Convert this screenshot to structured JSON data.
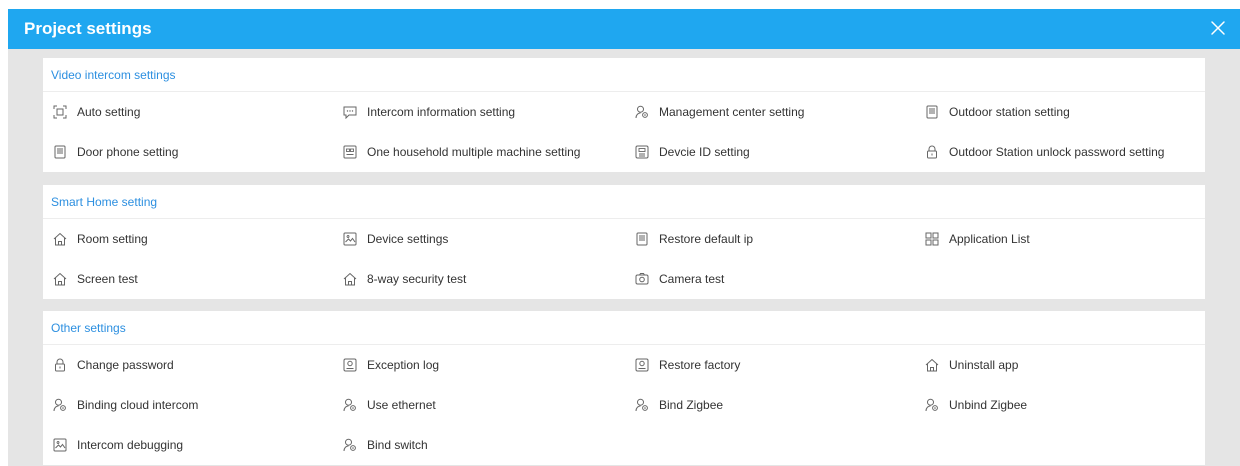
{
  "header": {
    "title": "Project settings",
    "background": "#1fa7f0"
  },
  "sections": [
    {
      "title": "Video intercom settings",
      "items": [
        {
          "label": "Auto setting",
          "icon": "scan-icon"
        },
        {
          "label": "Intercom information setting",
          "icon": "message-icon"
        },
        {
          "label": "Management center setting",
          "icon": "user-settings-icon"
        },
        {
          "label": "Outdoor station setting",
          "icon": "device-panel-icon"
        },
        {
          "label": "Door phone setting",
          "icon": "device-panel-icon"
        },
        {
          "label": "One household multiple machine setting",
          "icon": "multi-device-icon"
        },
        {
          "label": "Devcie ID setting",
          "icon": "id-device-icon"
        },
        {
          "label": "Outdoor Station unlock password setting",
          "icon": "lock-icon"
        }
      ]
    },
    {
      "title": "Smart Home setting",
      "items": [
        {
          "label": "Room setting",
          "icon": "home-icon"
        },
        {
          "label": "Device settings",
          "icon": "image-monitor-icon"
        },
        {
          "label": "Restore default ip",
          "icon": "device-panel-icon"
        },
        {
          "label": "Application List",
          "icon": "grid-icon"
        },
        {
          "label": "Screen test",
          "icon": "home-icon"
        },
        {
          "label": "8-way security test",
          "icon": "home-icon"
        },
        {
          "label": "Camera test",
          "icon": "camera-icon"
        }
      ]
    },
    {
      "title": "Other settings",
      "items": [
        {
          "label": "Change password",
          "icon": "lock-icon"
        },
        {
          "label": "Exception log",
          "icon": "log-icon"
        },
        {
          "label": "Restore factory",
          "icon": "log-icon"
        },
        {
          "label": "Uninstall app",
          "icon": "home-icon"
        },
        {
          "label": "Binding cloud intercom",
          "icon": "user-settings-icon"
        },
        {
          "label": "Use ethernet",
          "icon": "user-settings-icon"
        },
        {
          "label": "Bind Zigbee",
          "icon": "user-settings-icon"
        },
        {
          "label": "Unbind Zigbee",
          "icon": "user-settings-icon"
        },
        {
          "label": "Intercom debugging",
          "icon": "image-monitor-icon"
        },
        {
          "label": "Bind switch",
          "icon": "user-settings-icon"
        }
      ]
    }
  ]
}
